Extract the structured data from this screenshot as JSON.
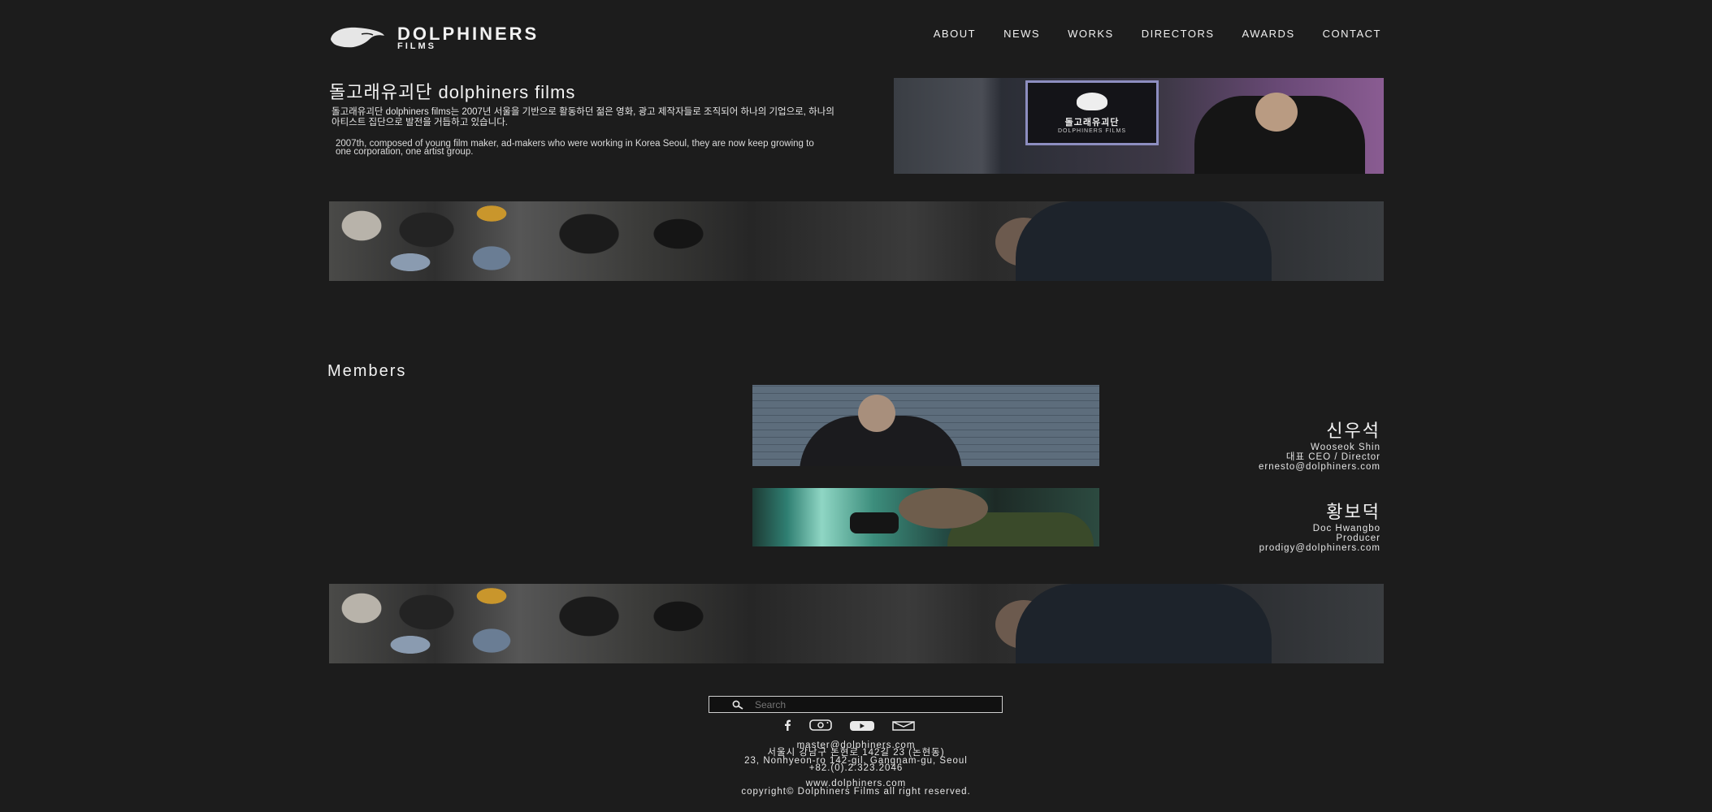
{
  "header": {
    "logo_text": "DOLPHINERS",
    "logo_sub": "FILMS",
    "nav": [
      "ABOUT",
      "NEWS",
      "WORKS",
      "DIRECTORS",
      "AWARDS",
      "CONTACT"
    ]
  },
  "intro": {
    "title": "돌고래유괴단 dolphiners films",
    "text_ko": "돌고래유괴단 dolphiners films는 2007년 서울을 기반으로 활동하던 젊은 영화, 광고 제작자들로 조직되어 하나의 기업으로, 하나의 아티스트 집단으로 발전을 거듭하고 있습니다.",
    "text_en": "2007th, composed of young film maker, ad-makers who were working in Korea Seoul, they are now keep growing to one corporation, one artist group.",
    "sign_text": "돌고래유괴단",
    "sign_sub": "DOLPHINERS FILMS"
  },
  "members": {
    "heading": "Members",
    "list": [
      {
        "name_ko": "신우석",
        "name_en": "Wooseok Shin",
        "role": "대표 CEO / Director",
        "email": "ernesto@dolphiners.com"
      },
      {
        "name_ko": "황보덕",
        "name_en": "Doc Hwangbo",
        "role": "Producer",
        "email": "prodigy@dolphiners.com"
      }
    ]
  },
  "footer": {
    "search_placeholder": "Search",
    "social_icons": [
      "facebook-icon",
      "instagram-icon",
      "youtube-icon",
      "mail-icon"
    ],
    "email": "master@dolphiners.com",
    "address_ko": "서울시 강남구 논현로 142길 23 (논현동)",
    "address_en": "23, Nonhyeon-ro 142-gil, Gangnam-gu, Seoul",
    "phone": "+82.(0).2.323.2046",
    "website": "www.dolphiners.com",
    "copyright": "copyright© Dolphiners Films all right reserved."
  },
  "colors": {
    "background": "#1c1c1c",
    "text": "#e8e8e8"
  }
}
